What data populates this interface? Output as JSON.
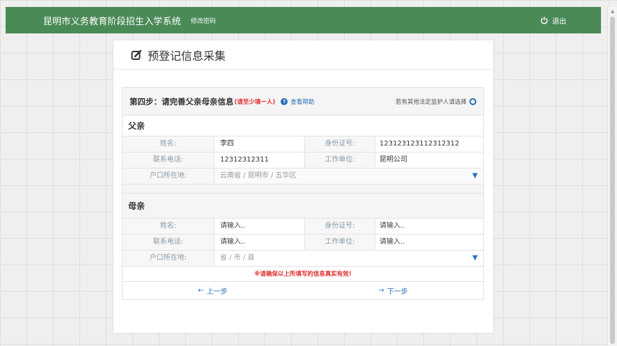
{
  "topbar": {
    "title": "昆明市义务教育阶段招生入学系统",
    "change_password": "修改密码",
    "logout": "退出"
  },
  "card": {
    "title": "预登记信息采集"
  },
  "step": {
    "title": "第四步：请完善父亲母亲信息",
    "required_note": "(请至少填一人)",
    "help": "查看帮助",
    "guardian_option": "若有其他法定监护人请选择"
  },
  "father": {
    "section": "父亲",
    "name_label": "姓名:",
    "name_value": "李四",
    "id_label": "身份证号:",
    "id_value": "123123123112312312",
    "phone_label": "联系电话:",
    "phone_value": "12312312311",
    "work_label": "工作单位:",
    "work_value": "昆明公司",
    "address_label": "户口所在地:",
    "address_value": "云南省 / 昆明市 / 五华区"
  },
  "mother": {
    "section": "母亲",
    "name_label": "姓名:",
    "name_placeholder": "请输入..",
    "id_label": "身份证号:",
    "id_placeholder": "请输入..",
    "phone_label": "联系电话:",
    "phone_placeholder": "请输入..",
    "work_label": "工作单位:",
    "work_placeholder": "请输入..",
    "address_label": "户口所在地:",
    "address_placeholder": "省 / 市 / 县"
  },
  "warning": "※请确保以上所填写的信息真实有效!",
  "nav": {
    "prev": "上一步",
    "next": "下一步"
  },
  "colors": {
    "topbar": "#4a8a57",
    "accent": "#2a6fb8",
    "warning": "#e03030"
  }
}
